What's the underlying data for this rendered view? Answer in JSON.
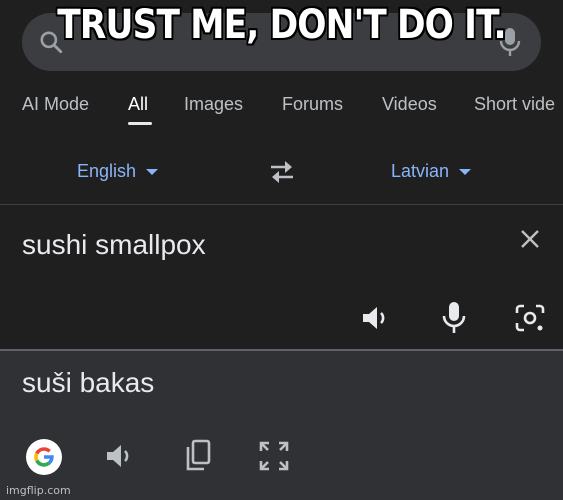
{
  "meme": {
    "caption": "TRUST ME, DON'T DO IT."
  },
  "search": {
    "placeholder": ""
  },
  "tabs": [
    "AI Mode",
    "All",
    "Images",
    "Forums",
    "Videos",
    "Short vide"
  ],
  "active_tab": "All",
  "translate": {
    "source_language": "English",
    "target_language": "Latvian",
    "source_text": "sushi smallpox",
    "translated_text": "suši bakas"
  },
  "watermark": "imgflip.com",
  "colors": {
    "background": "#1f1f1f",
    "search_bar": "#3c3d40",
    "accent_blue": "#8ab4f8",
    "text_primary": "#e8eaed",
    "text_secondary": "#bdc1c6",
    "target_panel": "#303134"
  },
  "icons": [
    "search-icon",
    "mic-icon",
    "swap-icon",
    "clear-icon",
    "speaker-icon",
    "mic-icon",
    "google-lens-icon",
    "google-logo-icon",
    "copy-icon",
    "expand-icon"
  ]
}
